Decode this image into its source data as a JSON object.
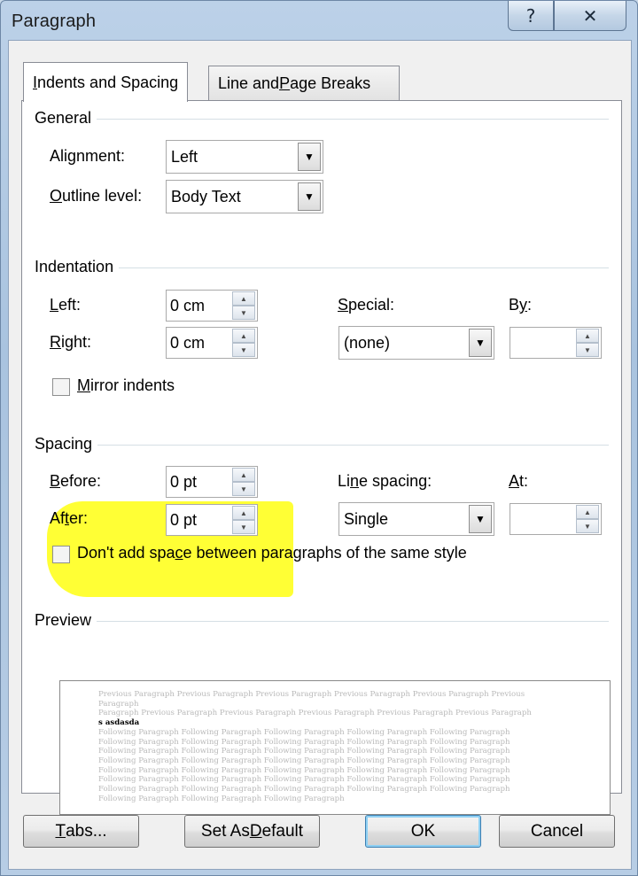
{
  "window": {
    "title": "Paragraph",
    "help": "?",
    "close": "✕"
  },
  "tabs": [
    {
      "label_pre": "",
      "label_key": "I",
      "label_post": "ndents and Spacing",
      "active": true
    },
    {
      "label_pre": "Line and ",
      "label_key": "P",
      "label_post": "age Breaks",
      "active": false
    }
  ],
  "general": {
    "heading": "General",
    "alignment": {
      "label_pre": "Ali",
      "label_key": "g",
      "label_post": "nment:",
      "value": "Left"
    },
    "outline": {
      "label_pre": "",
      "label_key": "O",
      "label_post": "utline level:",
      "value": "Body Text"
    }
  },
  "indentation": {
    "heading": "Indentation",
    "left": {
      "label_pre": "",
      "label_key": "L",
      "label_post": "eft:",
      "value": "0 cm"
    },
    "right": {
      "label_pre": "",
      "label_key": "R",
      "label_post": "ight:",
      "value": "0 cm"
    },
    "special": {
      "label_pre": "",
      "label_key": "S",
      "label_post": "pecial:",
      "value": "(none)"
    },
    "by": {
      "label_pre": "B",
      "label_key": "y",
      "label_post": ":",
      "value": ""
    },
    "mirror": {
      "label_pre": "",
      "label_key": "M",
      "label_post": "irror indents",
      "checked": false
    }
  },
  "spacing": {
    "heading": "Spacing",
    "before": {
      "label_pre": "",
      "label_key": "B",
      "label_post": "efore:",
      "value": "0 pt"
    },
    "after": {
      "label_pre": "Af",
      "label_key": "t",
      "label_post": "er:",
      "value": "0 pt"
    },
    "line_spacing": {
      "label_pre": "Li",
      "label_key": "n",
      "label_post": "e spacing:",
      "value": "Single"
    },
    "at": {
      "label_pre": "",
      "label_key": "A",
      "label_post": "t:",
      "value": ""
    },
    "dont_add": {
      "label_pre": "Don't add spa",
      "label_key": "c",
      "label_post": "e between paragraphs of the same style",
      "checked": false
    },
    "highlight_color": "#ffff2a"
  },
  "preview": {
    "heading": "Preview",
    "previous_lines": [
      "Previous Paragraph Previous Paragraph Previous Paragraph Previous Paragraph Previous Paragraph Previous Paragraph",
      "Paragraph Previous Paragraph Previous Paragraph Previous Paragraph Previous Paragraph Previous Paragraph"
    ],
    "current_line": "s asdasda",
    "following_lines": [
      "Following Paragraph Following Paragraph Following Paragraph Following Paragraph Following Paragraph",
      "Following Paragraph Following Paragraph Following Paragraph Following Paragraph Following Paragraph",
      "Following Paragraph Following Paragraph Following Paragraph Following Paragraph Following Paragraph",
      "Following Paragraph Following Paragraph Following Paragraph Following Paragraph Following Paragraph",
      "Following Paragraph Following Paragraph Following Paragraph Following Paragraph Following Paragraph",
      "Following Paragraph Following Paragraph Following Paragraph Following Paragraph Following Paragraph",
      "Following Paragraph Following Paragraph Following Paragraph Following Paragraph Following Paragraph",
      "Following Paragraph Following Paragraph Following Paragraph"
    ]
  },
  "buttons": {
    "tabs": {
      "label_pre": "",
      "label_key": "T",
      "label_post": "abs..."
    },
    "set_default": {
      "label_pre": "Set As ",
      "label_key": "D",
      "label_post": "efault"
    },
    "ok": {
      "label": "OK"
    },
    "cancel": {
      "label": "Cancel"
    }
  },
  "colors": {
    "title_bar": "#a9c3df",
    "panel": "#ffffff",
    "dialog_bg": "#f0f0f0",
    "ok_focus": "#8fd0f3"
  }
}
